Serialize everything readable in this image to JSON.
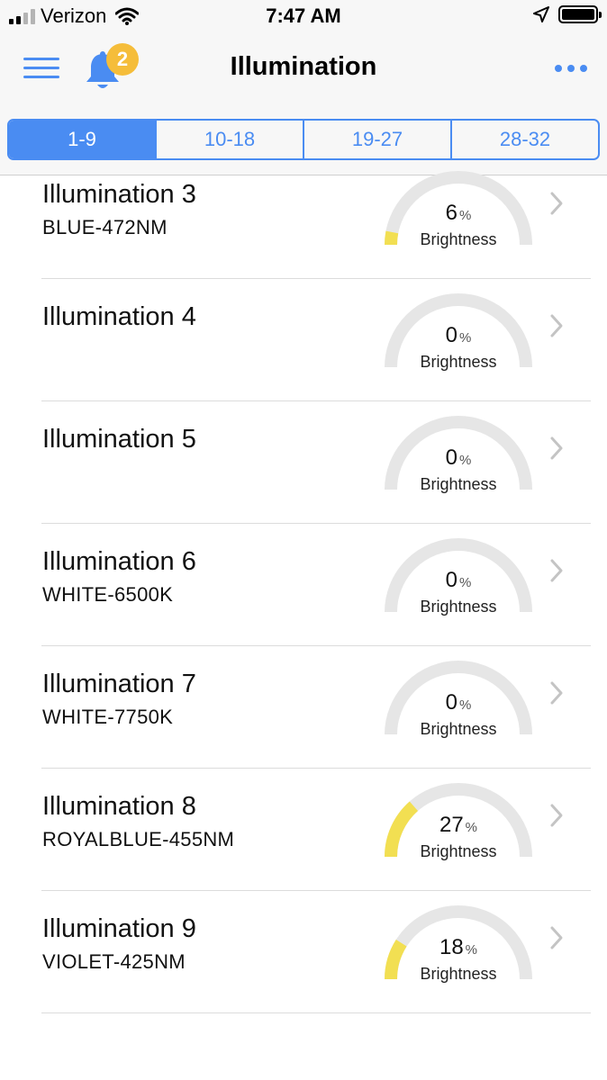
{
  "status_bar": {
    "carrier": "Verizon",
    "time": "7:47 AM"
  },
  "header": {
    "title": "Illumination",
    "notification_count": "2"
  },
  "tabs": [
    {
      "label": "1-9",
      "active": true
    },
    {
      "label": "10-18",
      "active": false
    },
    {
      "label": "19-27",
      "active": false
    },
    {
      "label": "28-32",
      "active": false
    }
  ],
  "gauge_label": "Brightness",
  "percent_unit": "%",
  "colors": {
    "accent": "#4a8cf2",
    "gauge_track": "#e6e6e6",
    "gauge_fill": "#f2df52",
    "badge": "#f5bd3a"
  },
  "items": [
    {
      "name": "Illumination 3",
      "subtitle": "BLUE-472NM",
      "brightness": "6"
    },
    {
      "name": "Illumination 4",
      "subtitle": "",
      "brightness": "0"
    },
    {
      "name": "Illumination 5",
      "subtitle": "",
      "brightness": "0"
    },
    {
      "name": "Illumination 6",
      "subtitle": "WHITE-6500K",
      "brightness": "0"
    },
    {
      "name": "Illumination 7",
      "subtitle": "WHITE-7750K",
      "brightness": "0"
    },
    {
      "name": "Illumination 8",
      "subtitle": "ROYALBLUE-455NM",
      "brightness": "27"
    },
    {
      "name": "Illumination 9",
      "subtitle": "VIOLET-425NM",
      "brightness": "18"
    }
  ]
}
